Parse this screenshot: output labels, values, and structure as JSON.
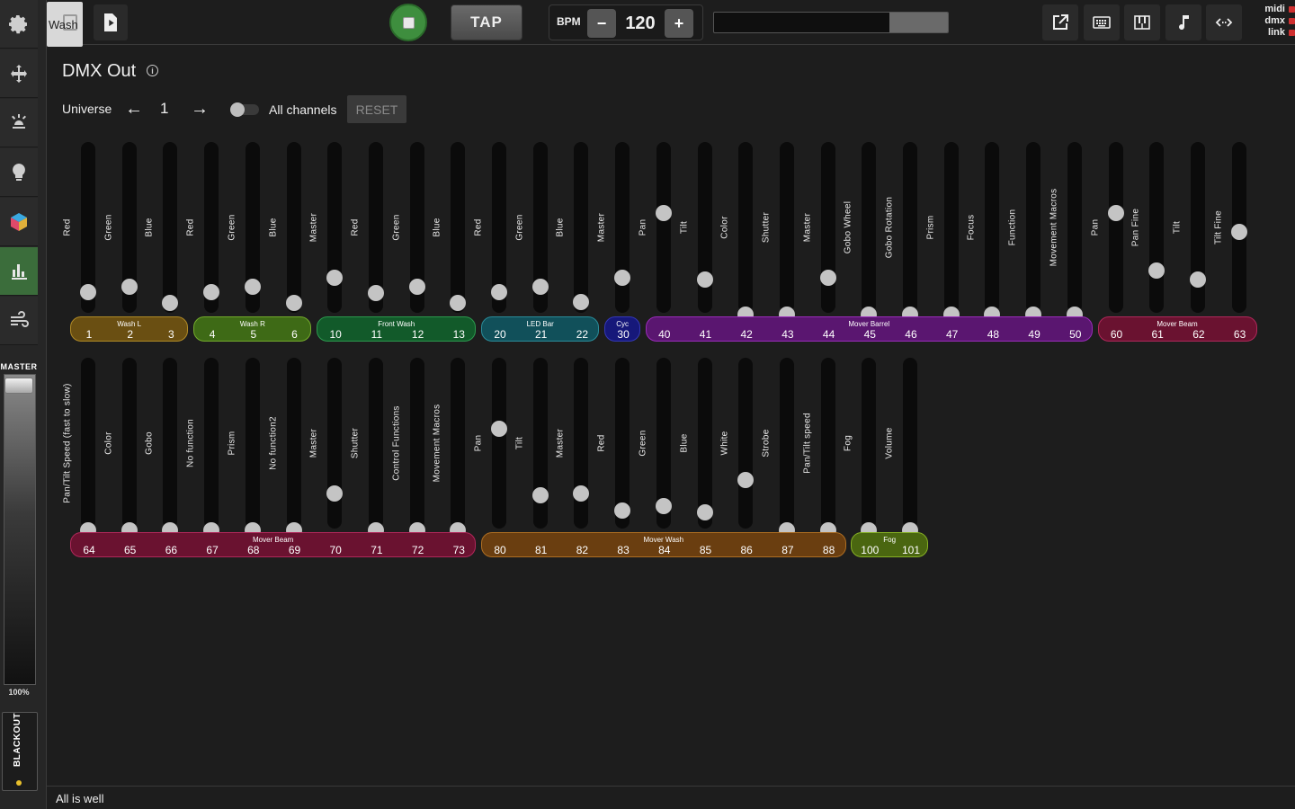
{
  "topbar": {
    "preset_tab_label": "Wash",
    "tap_label": "TAP",
    "bpm_label": "BPM",
    "bpm_minus": "−",
    "bpm_value": "120",
    "bpm_plus": "+",
    "progress_fraction": 0.25,
    "indicators": [
      {
        "label": "midi",
        "color": "#d03030"
      },
      {
        "label": "dmx",
        "color": "#d03030"
      },
      {
        "label": "link",
        "color": "#d03030"
      }
    ]
  },
  "sidebar": {
    "items": [
      {
        "name": "settings",
        "icon": "gear-icon"
      },
      {
        "name": "move",
        "icon": "move-arrows-icon"
      },
      {
        "name": "spotlight",
        "icon": "spotlight-icon"
      },
      {
        "name": "bulb",
        "icon": "lightbulb-icon"
      },
      {
        "name": "scenes",
        "icon": "cube-icon"
      },
      {
        "name": "dmx-out",
        "icon": "bar-chart-icon",
        "active": true
      },
      {
        "name": "fog",
        "icon": "wind-icon"
      }
    ],
    "master_label": "MASTER",
    "master_percent": "100%",
    "master_level": 1.0,
    "blackout_label": "BLACKOUT"
  },
  "main": {
    "title": "DMX Out",
    "universe_label": "Universe",
    "universe_prev": "←",
    "universe_value": "1",
    "universe_next": "→",
    "all_channels_label": "All channels",
    "all_channels_on": false,
    "reset_label": "RESET"
  },
  "rows": [
    {
      "faders": [
        {
          "label": "Red",
          "level": 0.18
        },
        {
          "label": "Green",
          "level": 0.22
        },
        {
          "label": "Blue",
          "level": 0.09
        },
        {
          "label": "Red",
          "level": 0.18
        },
        {
          "label": "Green",
          "level": 0.22
        },
        {
          "label": "Blue",
          "level": 0.09
        },
        {
          "label": "Master",
          "level": 0.29
        },
        {
          "label": "Red",
          "level": 0.17
        },
        {
          "label": "Green",
          "level": 0.22
        },
        {
          "label": "Blue",
          "level": 0.09
        },
        {
          "label": "Red",
          "level": 0.18
        },
        {
          "label": "Green",
          "level": 0.22
        },
        {
          "label": "Blue",
          "level": 0.1
        },
        {
          "label": "Master",
          "level": 0.29
        },
        {
          "label": "Pan",
          "level": 0.81
        },
        {
          "label": "Tilt",
          "level": 0.28
        },
        {
          "label": "Color",
          "level": 0.0
        },
        {
          "label": "Shutter",
          "level": 0.0
        },
        {
          "label": "Master",
          "level": 0.29
        },
        {
          "label": "Gobo Wheel",
          "level": 0.0
        },
        {
          "label": "Gobo Rotation",
          "level": 0.0
        },
        {
          "label": "Prism",
          "level": 0.0
        },
        {
          "label": "Focus",
          "level": 0.0
        },
        {
          "label": "Function",
          "level": 0.0
        },
        {
          "label": "Movement Macros",
          "level": 0.0
        },
        {
          "label": "Pan",
          "level": 0.81
        },
        {
          "label": "Pan Fine",
          "level": 0.35
        },
        {
          "label": "Tilt",
          "level": 0.28
        },
        {
          "label": "Tilt Fine",
          "level": 0.66
        }
      ],
      "groups": [
        {
          "name": "Wash L",
          "channels": [
            "1",
            "2",
            "3"
          ],
          "fill": "#6a4f12",
          "border": "#b08a26"
        },
        {
          "name": "Wash R",
          "channels": [
            "4",
            "5",
            "6"
          ],
          "fill": "#3e6a16",
          "border": "#74ab2c"
        },
        {
          "name": "Front Wash",
          "channels": [
            "10",
            "11",
            "12",
            "13"
          ],
          "fill": "#125a2a",
          "border": "#2c9a4e"
        },
        {
          "name": "LED Bar",
          "channels": [
            "20",
            "21",
            "22"
          ],
          "fill": "#11505a",
          "border": "#2a8c9a"
        },
        {
          "name": "Cyc",
          "channels": [
            "30"
          ],
          "fill": "#16187a",
          "border": "#3438b8"
        },
        {
          "name": "Mover Barrel",
          "channels": [
            "40",
            "41",
            "42",
            "43",
            "44",
            "45",
            "46",
            "47",
            "48",
            "49",
            "50"
          ],
          "fill": "#5a1670",
          "border": "#9a2cba"
        },
        {
          "name": "Mover Beam",
          "channels": [
            "60",
            "61",
            "62",
            "63"
          ],
          "fill": "#6a1230",
          "border": "#b0285a"
        }
      ]
    },
    {
      "faders": [
        {
          "label": "Pan/Tilt Speed (fast to slow)",
          "level": 0.0
        },
        {
          "label": "Color",
          "level": 0.0
        },
        {
          "label": "Gobo",
          "level": 0.0
        },
        {
          "label": "No function",
          "level": 0.0
        },
        {
          "label": "Prism",
          "level": 0.0
        },
        {
          "label": "No function2",
          "level": 0.0
        },
        {
          "label": "Master",
          "level": 0.29
        },
        {
          "label": "Shutter",
          "level": 0.0
        },
        {
          "label": "Control Functions",
          "level": 0.0
        },
        {
          "label": "Movement Macros",
          "level": 0.0
        },
        {
          "label": "Pan",
          "level": 0.81
        },
        {
          "label": "Tilt",
          "level": 0.28
        },
        {
          "label": "Master",
          "level": 0.29
        },
        {
          "label": "Red",
          "level": 0.16
        },
        {
          "label": "Green",
          "level": 0.19
        },
        {
          "label": "Blue",
          "level": 0.14
        },
        {
          "label": "White",
          "level": 0.4
        },
        {
          "label": "Strobe",
          "level": 0.0
        },
        {
          "label": "Pan/Tilt speed",
          "level": 0.0
        },
        {
          "label": "Fog",
          "level": 0.0
        },
        {
          "label": "Volume",
          "level": 0.0
        }
      ],
      "groups": [
        {
          "name": "Mover Beam",
          "channels": [
            "64",
            "65",
            "66",
            "67",
            "68",
            "69",
            "70",
            "71",
            "72",
            "73"
          ],
          "fill": "#6a1230",
          "border": "#b0285a"
        },
        {
          "name": "Mover Wash",
          "channels": [
            "80",
            "81",
            "82",
            "83",
            "84",
            "85",
            "86",
            "87",
            "88"
          ],
          "fill": "#6a3e10",
          "border": "#ae6e22"
        },
        {
          "name": "Fog",
          "channels": [
            "100",
            "101"
          ],
          "fill": "#4a6610",
          "border": "#86b024"
        }
      ]
    }
  ],
  "status": {
    "text": "All is well"
  }
}
